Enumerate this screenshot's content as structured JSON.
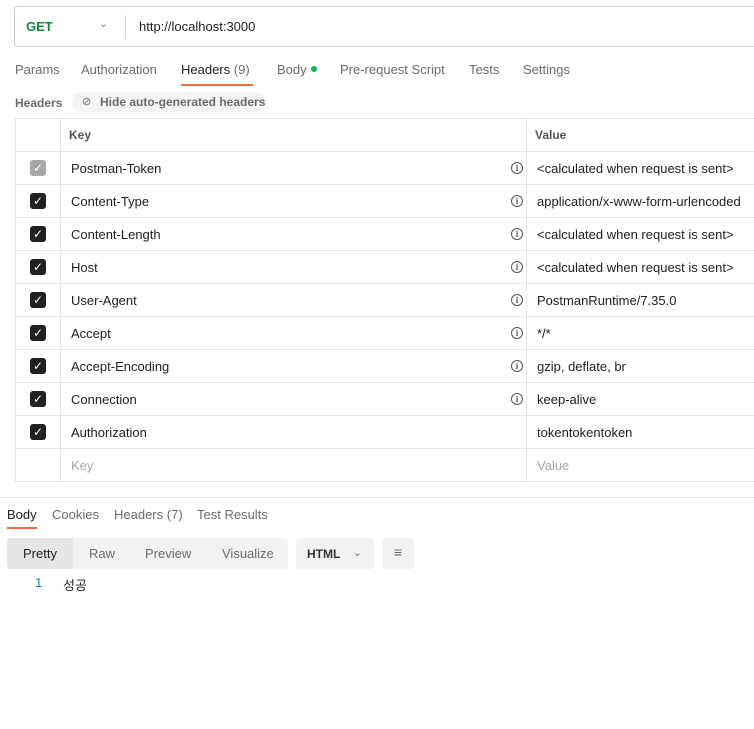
{
  "request": {
    "method": "GET",
    "url": "http://localhost:3000"
  },
  "tabs": [
    {
      "label": "Params"
    },
    {
      "label": "Authorization"
    },
    {
      "label": "Headers",
      "count": "(9)"
    },
    {
      "label": "Body"
    },
    {
      "label": "Pre-request Script"
    },
    {
      "label": "Tests"
    },
    {
      "label": "Settings"
    }
  ],
  "headers_section": {
    "label": "Headers",
    "hide_button": "Hide auto-generated headers",
    "col_key": "Key",
    "col_value": "Value",
    "key_placeholder": "Key",
    "value_placeholder": "Value",
    "rows": [
      {
        "key": "Postman-Token",
        "value": "<calculated when request is sent>",
        "checked": true,
        "disabled": true,
        "info": true
      },
      {
        "key": "Content-Type",
        "value": "application/x-www-form-urlencoded",
        "checked": true,
        "info": true
      },
      {
        "key": "Content-Length",
        "value": "<calculated when request is sent>",
        "checked": true,
        "info": true
      },
      {
        "key": "Host",
        "value": "<calculated when request is sent>",
        "checked": true,
        "info": true
      },
      {
        "key": "User-Agent",
        "value": "PostmanRuntime/7.35.0",
        "checked": true,
        "info": true
      },
      {
        "key": "Accept",
        "value": "*/*",
        "checked": true,
        "info": true
      },
      {
        "key": "Accept-Encoding",
        "value": "gzip, deflate, br",
        "checked": true,
        "info": true
      },
      {
        "key": "Connection",
        "value": "keep-alive",
        "checked": true,
        "info": true
      },
      {
        "key": "Authorization",
        "value": "tokentokentoken",
        "checked": true,
        "info": false
      }
    ]
  },
  "response": {
    "tabs": [
      {
        "label": "Body"
      },
      {
        "label": "Cookies"
      },
      {
        "label": "Headers",
        "count": "(7)"
      },
      {
        "label": "Test Results"
      }
    ],
    "views": [
      "Pretty",
      "Raw",
      "Preview",
      "Visualize"
    ],
    "format": "HTML",
    "lines": [
      {
        "num": "1",
        "text": "성공"
      }
    ]
  },
  "colors": {
    "accent": "#f26b3a",
    "method": "#0d8a3e"
  }
}
